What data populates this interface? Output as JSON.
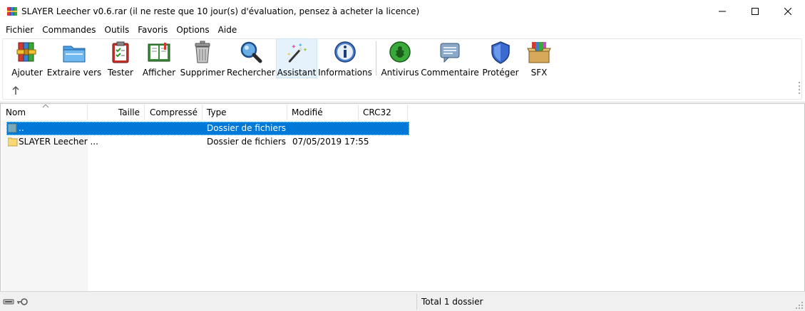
{
  "window": {
    "title": "SLAYER Leecher v0.6.rar (il ne reste que 10 jour(s) d'évaluation, pensez à acheter la licence)",
    "app_icon": "winrar-icon"
  },
  "menu": [
    "Fichier",
    "Commandes",
    "Outils",
    "Favoris",
    "Options",
    "Aide"
  ],
  "toolbar": {
    "buttons": [
      {
        "label": "Ajouter",
        "icon": "add-archive-icon"
      },
      {
        "label": "Extraire vers",
        "icon": "extract-folder-icon"
      },
      {
        "label": "Tester",
        "icon": "test-clipboard-icon"
      },
      {
        "label": "Afficher",
        "icon": "view-book-icon"
      },
      {
        "label": "Supprimer",
        "icon": "trash-icon"
      },
      {
        "label": "Rechercher",
        "icon": "magnifier-icon"
      },
      {
        "label": "Assistant",
        "icon": "wizard-wand-icon"
      },
      {
        "label": "Informations",
        "icon": "info-icon"
      },
      {
        "label": "Antivirus",
        "icon": "antivirus-bug-icon"
      },
      {
        "label": "Commentaire",
        "icon": "comment-icon"
      },
      {
        "label": "Protéger",
        "icon": "shield-icon"
      },
      {
        "label": "SFX",
        "icon": "sfx-box-icon"
      }
    ],
    "active": "Assistant"
  },
  "columns": [
    "Nom",
    "Taille",
    "Compressé",
    "Type",
    "Modifié",
    "CRC32"
  ],
  "rows": [
    {
      "name": "..",
      "size": "",
      "packed": "",
      "type": "Dossier de fichiers",
      "modified": "",
      "crc": "",
      "selected": true
    },
    {
      "name": "SLAYER Leecher ...",
      "size": "",
      "packed": "",
      "type": "Dossier de fichiers",
      "modified": "07/05/2019 17:55",
      "crc": "",
      "selected": false
    }
  ],
  "status": {
    "text": "Total 1 dossier"
  },
  "colors": {
    "selection": "#0078d7",
    "folder": "#f8d775",
    "active_button": "#e5f1fb"
  }
}
